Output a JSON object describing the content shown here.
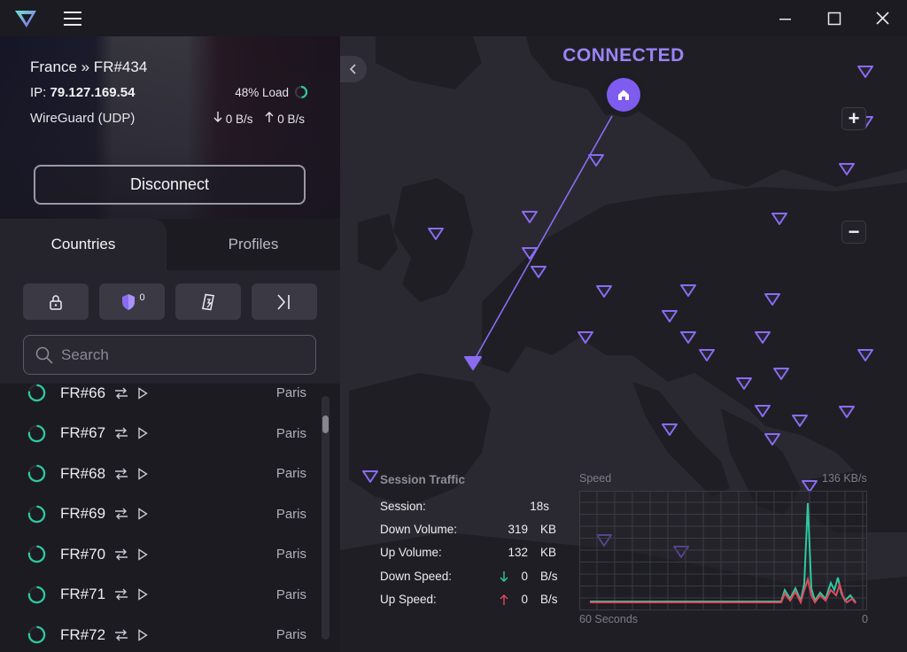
{
  "titlebar": {
    "logo_icon": "proton-vpn-logo-icon",
    "menu_icon": "hamburger-icon",
    "minimize_icon": "minimize-icon",
    "maximize_icon": "maximize-icon",
    "close_icon": "close-icon"
  },
  "connection": {
    "server": "France » FR#434",
    "ip_label": "IP:",
    "ip": "79.127.169.54",
    "load": "48% Load",
    "load_value": 48,
    "protocol": "WireGuard (UDP)",
    "down": "0 B/s",
    "up": "0 B/s",
    "disconnect_label": "Disconnect"
  },
  "tabs": {
    "countries": "Countries",
    "profiles": "Profiles"
  },
  "filters": {
    "secure_core_badge": "0",
    "icons": [
      "lock-icon",
      "shield-icon",
      "p2p-icon",
      "tor-icon"
    ]
  },
  "search": {
    "placeholder": "Search"
  },
  "servers": [
    {
      "name": "FR#66",
      "city": "Paris"
    },
    {
      "name": "FR#67",
      "city": "Paris"
    },
    {
      "name": "FR#68",
      "city": "Paris"
    },
    {
      "name": "FR#69",
      "city": "Paris"
    },
    {
      "name": "FR#70",
      "city": "Paris"
    },
    {
      "name": "FR#71",
      "city": "Paris"
    },
    {
      "name": "FR#72",
      "city": "Paris"
    }
  ],
  "map": {
    "status": "CONNECTED",
    "zoom_in": "+",
    "zoom_out": "−",
    "accent": "#8a6cf2"
  },
  "session": {
    "title": "Session Traffic",
    "rows": [
      {
        "label": "Session:",
        "value": "18s",
        "unit": ""
      },
      {
        "label": "Down Volume:",
        "value": "319",
        "unit": "KB"
      },
      {
        "label": "Up Volume:",
        "value": "132",
        "unit": "KB"
      },
      {
        "label": "Down Speed:",
        "value": "0",
        "unit": "B/s"
      },
      {
        "label": "Up Speed:",
        "value": "0",
        "unit": "B/s"
      }
    ],
    "graph": {
      "speed_label": "Speed",
      "max_label": "136 KB/s",
      "duration_label": "60 Seconds",
      "zero_label": "0"
    }
  }
}
